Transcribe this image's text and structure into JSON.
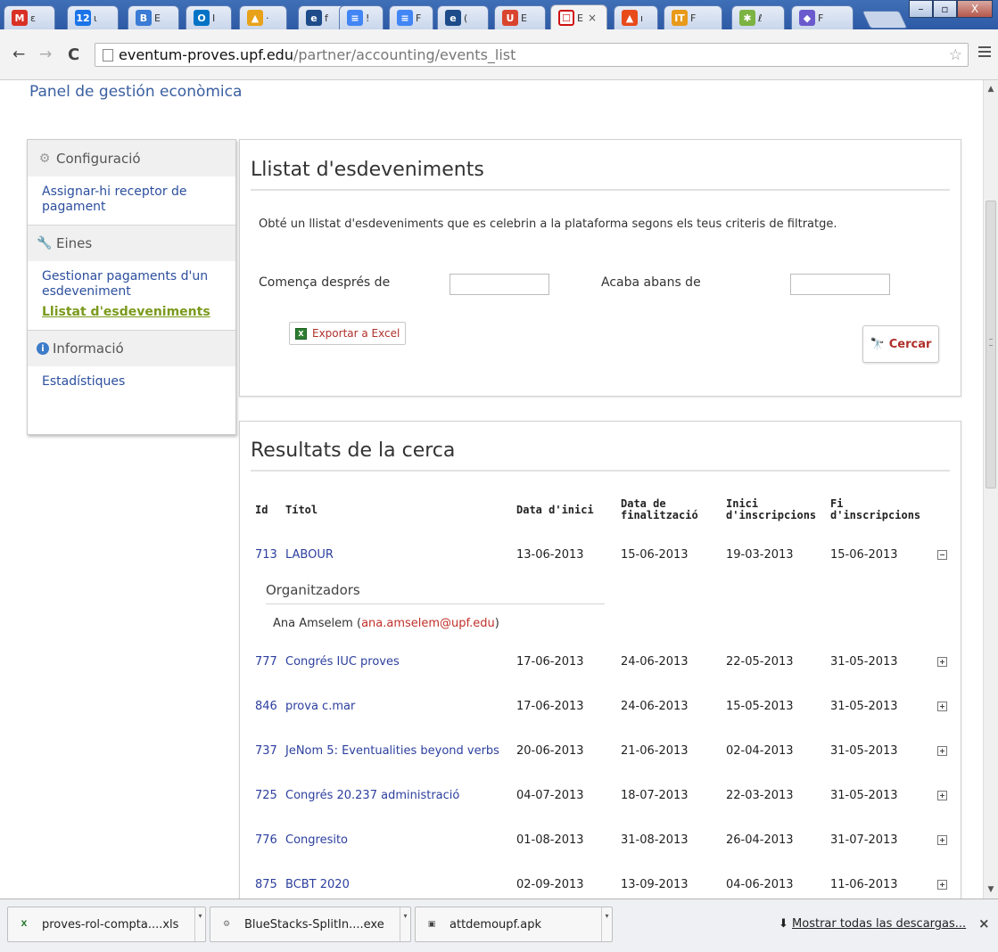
{
  "browser": {
    "tabs": [
      {
        "favicon": "M",
        "color": "#d93025",
        "title": "ε"
      },
      {
        "favicon": "12",
        "color": "#1a73e8",
        "title": "ι"
      },
      {
        "favicon": "B",
        "color": "#3a7bd5",
        "title": "E"
      },
      {
        "favicon": "O",
        "color": "#0073c6",
        "title": "I"
      },
      {
        "favicon": "▲",
        "color": "#e8a21a",
        "title": "·"
      },
      {
        "favicon": "e",
        "color": "#1e4c8a",
        "title": "f"
      },
      {
        "favicon": "≡",
        "color": "#4285f4",
        "title": "!"
      },
      {
        "favicon": "≡",
        "color": "#4285f4",
        "title": "F"
      },
      {
        "favicon": "e",
        "color": "#1e4c8a",
        "title": "("
      },
      {
        "favicon": "U",
        "color": "#d9442f",
        "title": "E"
      },
      {
        "favicon": "☐",
        "color": "#d01010",
        "title": "E"
      },
      {
        "favicon": "▲",
        "color": "#e84a1a",
        "title": "ı"
      },
      {
        "favicon": "IT",
        "color": "#e89a1a",
        "title": "F"
      },
      {
        "favicon": "✱",
        "color": "#7cb342",
        "title": "ℓ"
      },
      {
        "favicon": "◆",
        "color": "#6a5acd",
        "title": "F"
      }
    ],
    "active_tab_close": "×",
    "window_buttons": {
      "minimize": "–",
      "maximize": "▫",
      "close": "X"
    },
    "back": "←",
    "forward": "→",
    "reload": "C",
    "url_host": "eventum-proves.upf.edu",
    "url_path": "/partner/accounting/events_list"
  },
  "page": {
    "panel_title": "Panel de gestión econòmica",
    "sidebar": {
      "sections": [
        {
          "icon": "gear-icon",
          "glyph": "⚙",
          "title": "Configuració",
          "links": [
            {
              "label": "Assignar-hi receptor de pagament",
              "active": false
            }
          ]
        },
        {
          "icon": "wrench-icon",
          "glyph": "🔧",
          "title": "Eines",
          "links": [
            {
              "label": "Gestionar pagaments d'un esdeveniment",
              "active": false
            },
            {
              "label": "Llistat d'esdeveniments",
              "active": true
            }
          ]
        },
        {
          "icon": "info-icon",
          "glyph": "i",
          "title": "Informació",
          "links": [
            {
              "label": "Estadístiques",
              "active": false
            }
          ]
        }
      ]
    },
    "filter": {
      "title": "Llistat d'esdeveniments",
      "description": "Obté un llistat d'esdeveniments que es celebrin a la plataforma segons els teus criteris de filtratge.",
      "start_label": "Comença després de",
      "start_value": "",
      "end_label": "Acaba abans de",
      "end_value": "",
      "export_label": "Exportar a Excel",
      "search_label": "Cercar"
    },
    "results": {
      "title": "Resultats de la cerca",
      "columns": [
        "Id",
        "Títol",
        "Data d'inici",
        "Data de finalització",
        "Inici d'inscripcions",
        "Fi d'inscripcions"
      ],
      "organizers_title": "Organitzadors",
      "rows": [
        {
          "id": "713",
          "title": "LABOUR",
          "start": "13-06-2013",
          "end": "15-06-2013",
          "reg_start": "19-03-2013",
          "reg_end": "15-06-2013",
          "expanded": true,
          "organizer_name": "Ana Amselem",
          "organizer_email": "ana.amselem@upf.edu"
        },
        {
          "id": "777",
          "title": "Congrés IUC proves",
          "start": "17-06-2013",
          "end": "24-06-2013",
          "reg_start": "22-05-2013",
          "reg_end": "31-05-2013",
          "expanded": false
        },
        {
          "id": "846",
          "title": "prova c.mar",
          "start": "17-06-2013",
          "end": "24-06-2013",
          "reg_start": "15-05-2013",
          "reg_end": "31-05-2013",
          "expanded": false
        },
        {
          "id": "737",
          "title": "JeNom 5: Eventualities beyond verbs",
          "start": "20-06-2013",
          "end": "21-06-2013",
          "reg_start": "02-04-2013",
          "reg_end": "31-05-2013",
          "expanded": false
        },
        {
          "id": "725",
          "title": "Congrés 20.237 administració",
          "start": "04-07-2013",
          "end": "18-07-2013",
          "reg_start": "22-03-2013",
          "reg_end": "31-05-2013",
          "expanded": false
        },
        {
          "id": "776",
          "title": "Congresito",
          "start": "01-08-2013",
          "end": "31-08-2013",
          "reg_start": "26-04-2013",
          "reg_end": "31-07-2013",
          "expanded": false
        },
        {
          "id": "875",
          "title": "BCBT 2020",
          "start": "02-09-2013",
          "end": "13-09-2013",
          "reg_start": "04-06-2013",
          "reg_end": "11-06-2013",
          "expanded": false
        }
      ]
    }
  },
  "downloads": {
    "items": [
      {
        "icon": "excel-file-icon",
        "glyph": "X",
        "color": "#2e7d32",
        "name": "proves-rol-compta....xls"
      },
      {
        "icon": "installer-icon",
        "glyph": "⚙",
        "color": "#6b6b6b",
        "name": "BlueStacks-SplitIn....exe"
      },
      {
        "icon": "apk-file-icon",
        "glyph": "▣",
        "color": "#444444",
        "name": "attdemoupf.apk"
      }
    ],
    "show_all_label": "Mostrar todas las descargas...",
    "close": "×"
  }
}
